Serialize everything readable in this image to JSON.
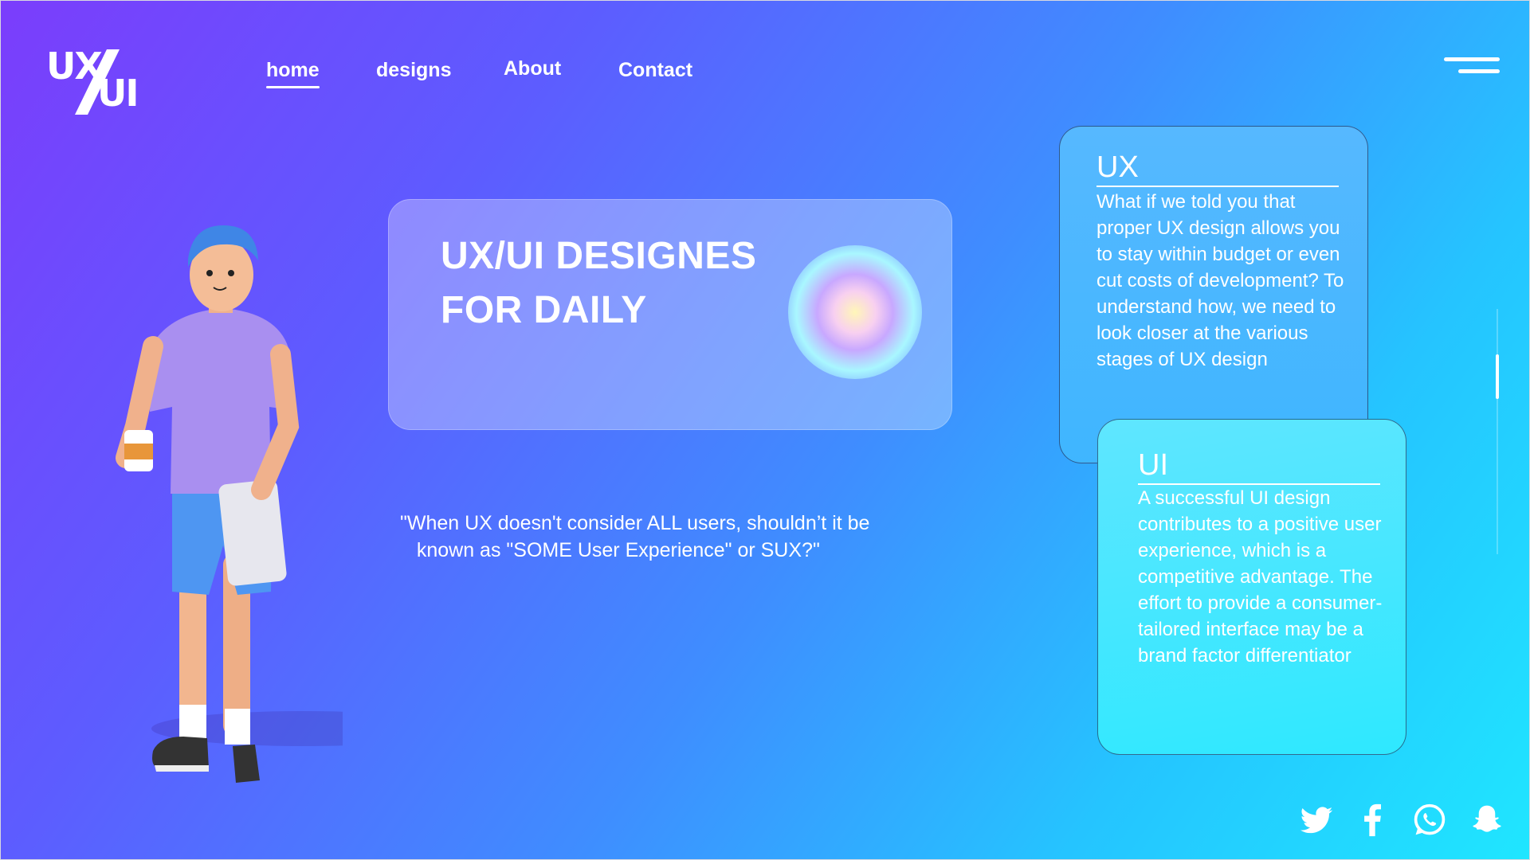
{
  "logo": {
    "top": "UX",
    "bottom": "UI"
  },
  "nav": {
    "items": [
      {
        "label": "home",
        "active": true
      },
      {
        "label": "designs",
        "active": false
      },
      {
        "label": "About",
        "active": false
      },
      {
        "label": "Contact",
        "active": false
      }
    ]
  },
  "hero": {
    "title_line1": "UX/UI DESIGNES",
    "title_line2": "FOR DAILY"
  },
  "quote": "\"When UX doesn't consider ALL users, shouldn’t it be\n   known as \"SOME User Experience\" or SUX?\"",
  "cards": {
    "ux": {
      "title": "UX",
      "body": "What if we told you that proper UX design allows you to stay within budget or even cut costs of development? To understand how, we need to look closer at the various stages of UX design"
    },
    "ui": {
      "title": "UI",
      "body": "A successful UI design contributes to a positive user experience, which is a competitive advantage. The effort to provide a consumer-tailored interface may be a brand factor differentiator"
    }
  },
  "social": [
    "twitter-icon",
    "facebook-icon",
    "whatsapp-icon",
    "snapchat-icon"
  ],
  "colors": {
    "gradient_start": "#7b3dfc",
    "gradient_end": "#1fe6ff",
    "text": "#ffffff"
  }
}
